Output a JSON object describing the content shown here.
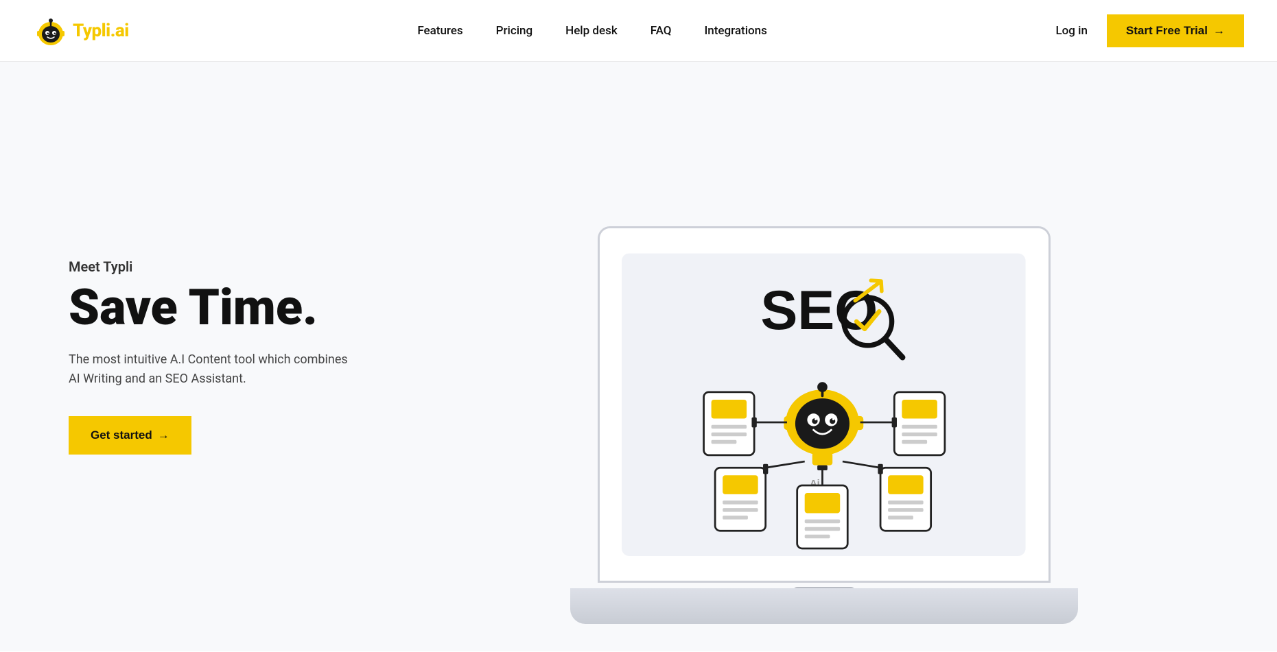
{
  "brand": {
    "name_part1": "Typli",
    "name_part2": ".ai"
  },
  "nav": {
    "links": [
      {
        "label": "Features",
        "href": "#"
      },
      {
        "label": "Pricing",
        "href": "#"
      },
      {
        "label": "Help desk",
        "href": "#"
      },
      {
        "label": "FAQ",
        "href": "#"
      },
      {
        "label": "Integrations",
        "href": "#"
      }
    ],
    "login_label": "Log in",
    "cta_label": "Start Free Trial",
    "cta_arrow": "→"
  },
  "hero": {
    "pretitle": "Meet Typli",
    "title": "Save Time.",
    "description": "The most intuitive A.I Content tool which combines AI Writing and an SEO Assistant.",
    "btn_label": "Get started",
    "btn_arrow": "→"
  }
}
